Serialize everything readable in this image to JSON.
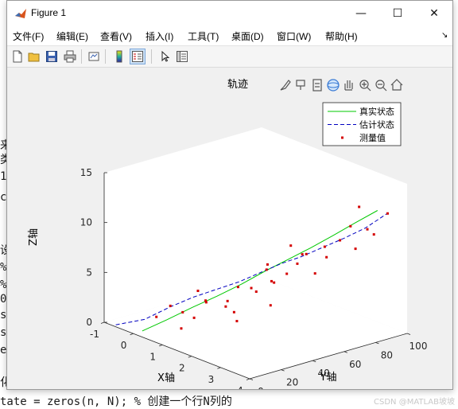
{
  "window": {
    "title": "Figure 1",
    "minimize": "—",
    "maximize": "☐",
    "close": "✕"
  },
  "menu": [
    "文件(F)",
    "编辑(E)",
    "查看(V)",
    "插入(I)",
    "工具(T)",
    "桌面(D)",
    "窗口(W)",
    "帮助(H)"
  ],
  "menu_arrow": "↘",
  "toolbar_icons": [
    "new-figure-icon",
    "open-icon",
    "save-icon",
    "print-icon",
    "link-plot-icon",
    "colorbar-icon",
    "legend-icon",
    "pointer-icon",
    "property-editor-icon"
  ],
  "axes_toolbar_icons": [
    "brush-icon",
    "datatip-icon",
    "export-icon",
    "rotate-3d-icon",
    "pan-icon",
    "zoom-in-icon",
    "zoom-out-icon",
    "home-icon"
  ],
  "background_code": [
    "来",
    "类",
    "1",
    "c",
    "设",
    "%",
    "%",
    "0;",
    "se",
    "s-",
    "en",
    "化",
    "tate = zeros(n, N); % 创建一个行N列的"
  ],
  "watermark": "CSDN @MATLAB坡坡",
  "colors": {
    "true_state": "#00c800",
    "estimate": "#0000c0",
    "measurement": "#d40000"
  },
  "chart_data": {
    "type": "scatter",
    "projection": "3d",
    "title": "轨迹",
    "xlabel": "X轴",
    "ylabel": "Y轴",
    "zlabel": "Z轴",
    "xlim": [
      -1,
      4
    ],
    "ylim": [
      0,
      100
    ],
    "zlim": [
      0,
      15
    ],
    "xticks": [
      "-1",
      "0",
      "1",
      "2",
      "3",
      "4"
    ],
    "yticks": [
      "0",
      "20",
      "40",
      "60",
      "80",
      "100"
    ],
    "zticks": [
      "0",
      "5",
      "10",
      "15"
    ],
    "legend": {
      "position": "top-right",
      "entries": [
        "真实状态",
        "估计状态",
        "测量值"
      ]
    },
    "grid": false,
    "series": [
      {
        "name": "真实状态",
        "style": "solid-line",
        "color": "#00c800",
        "points": [
          [
            0.2,
            2,
            0.4
          ],
          [
            0.5,
            12,
            1.4
          ],
          [
            0.8,
            23,
            2.5
          ],
          [
            1.1,
            33,
            3.5
          ],
          [
            1.4,
            43,
            4.6
          ],
          [
            1.7,
            52,
            5.8
          ],
          [
            2.0,
            61,
            6.9
          ],
          [
            2.3,
            70,
            8.0
          ],
          [
            2.6,
            79,
            9.2
          ],
          [
            2.9,
            87,
            10.4
          ],
          [
            3.2,
            96,
            11.6
          ]
        ]
      },
      {
        "name": "估计状态",
        "style": "dashed-line",
        "color": "#0000c0",
        "points": [
          [
            -0.6,
            0,
            0.2
          ],
          [
            -0.1,
            9,
            0.9
          ],
          [
            0.3,
            18,
            2.2
          ],
          [
            0.6,
            27,
            3.1
          ],
          [
            0.9,
            36,
            3.8
          ],
          [
            1.2,
            45,
            4.5
          ],
          [
            1.5,
            53,
            5.4
          ],
          [
            1.8,
            61,
            6.3
          ],
          [
            2.1,
            68,
            7.0
          ],
          [
            2.4,
            76,
            7.9
          ],
          [
            2.7,
            84,
            8.8
          ],
          [
            3.0,
            92,
            9.8
          ],
          [
            3.3,
            100,
            11.2
          ]
        ]
      },
      {
        "name": "测量值",
        "style": "markers",
        "color": "#d40000",
        "points": [
          [
            0.3,
            18,
            2.3
          ],
          [
            0.6,
            30,
            3.6
          ],
          [
            0.9,
            22,
            1.6
          ],
          [
            1.1,
            26,
            3.2
          ],
          [
            1.4,
            34,
            3.3
          ],
          [
            1.6,
            37,
            4.8
          ],
          [
            1.9,
            43,
            4.4
          ],
          [
            2.1,
            49,
            5.4
          ],
          [
            2.3,
            55,
            6.1
          ],
          [
            2.5,
            58,
            7.2
          ],
          [
            2.7,
            60,
            8.3
          ],
          [
            2.9,
            68,
            8.9
          ],
          [
            3.1,
            74,
            9.5
          ],
          [
            3.3,
            77,
            11.0
          ],
          [
            3.5,
            84,
            10.6
          ],
          [
            0.2,
            11,
            1.4
          ],
          [
            0.7,
            33,
            2.6
          ],
          [
            1.3,
            40,
            1.8
          ],
          [
            1.5,
            31,
            3.0
          ],
          [
            1.8,
            52,
            6.6
          ],
          [
            2.0,
            38,
            5.1
          ],
          [
            2.2,
            44,
            6.9
          ],
          [
            2.4,
            63,
            7.8
          ],
          [
            2.6,
            52,
            9.4
          ],
          [
            2.8,
            71,
            7.6
          ],
          [
            3.0,
            60,
            6.7
          ],
          [
            3.2,
            82,
            8.4
          ],
          [
            3.4,
            90,
            9.7
          ],
          [
            3.6,
            95,
            11.8
          ],
          [
            1.0,
            12,
            1.1
          ],
          [
            1.7,
            58,
            4.4
          ],
          [
            2.5,
            41,
            3.8
          ],
          [
            0.4,
            24,
            1.5
          ],
          [
            2.1,
            27,
            2.4
          ],
          [
            3.0,
            88,
            12.1
          ]
        ]
      }
    ]
  }
}
